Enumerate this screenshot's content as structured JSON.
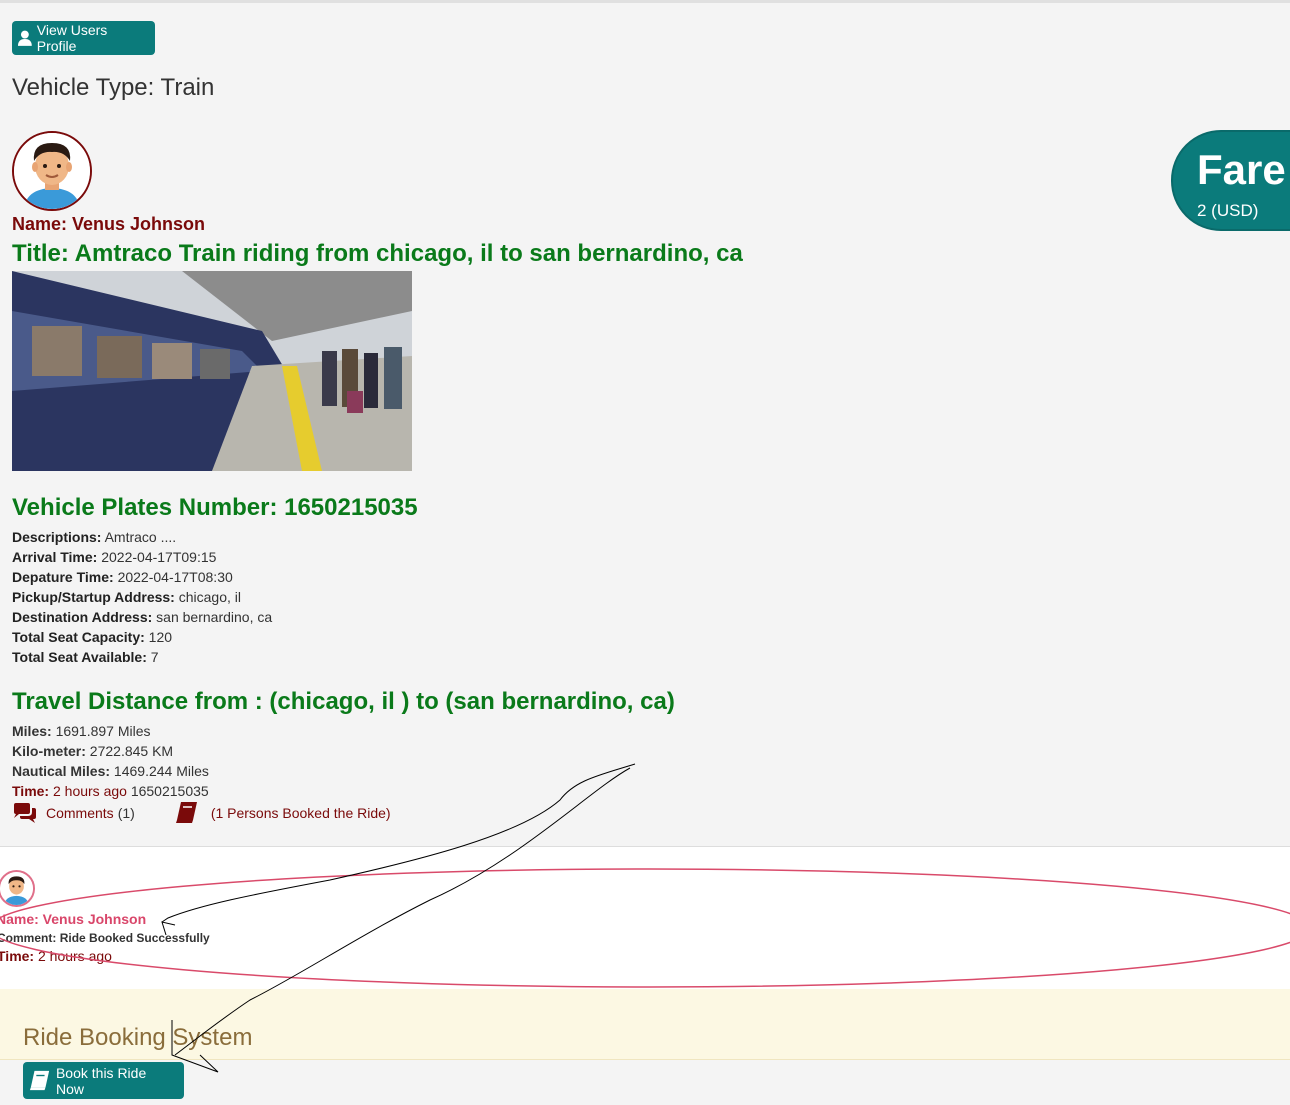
{
  "header": {
    "view_profile_label": "View Users Profile",
    "vehicle_type": "Vehicle Type: Train"
  },
  "ride": {
    "name_label": "Name: Venus Johnson",
    "title": "Title: Amtraco Train riding from chicago, il to san bernardino, ca",
    "plates": "Vehicle Plates Number: 1650215035",
    "details": [
      {
        "label": "Descriptions:",
        "value": "Amtraco ...."
      },
      {
        "label": "Arrival Time:",
        "value": "2022-04-17T09:15"
      },
      {
        "label": "Depature Time:",
        "value": "2022-04-17T08:30"
      },
      {
        "label": "Pickup/Startup Address:",
        "value": "chicago, il"
      },
      {
        "label": "Destination Address:",
        "value": "san bernardino, ca"
      },
      {
        "label": "Total Seat Capacity:",
        "value": "120"
      },
      {
        "label": "Total Seat Available:",
        "value": "7"
      }
    ],
    "distance_heading": "Travel Distance from : (chicago, il ) to (san bernardino, ca)",
    "distance": [
      {
        "label": "Miles:",
        "value": "1691.897 Miles"
      },
      {
        "label": "Kilo-meter:",
        "value": "2722.845 KM"
      },
      {
        "label": "Nautical Miles:",
        "value": "1469.244 Miles"
      }
    ],
    "time_label": "Time:",
    "time_value": "2 hours ago",
    "time_id": "1650215035",
    "comments_link": "Comments",
    "comments_count": "(1)",
    "booked_link": "(1 Persons Booked the Ride)"
  },
  "fare": {
    "label": "Fare",
    "amount": "2 (USD)"
  },
  "comment": {
    "name": "Name: Venus Johnson",
    "comment_label": "Comment:",
    "comment_text": "Ride Booked Successfully",
    "time_label": "Time:",
    "time_value": "2 hours ago"
  },
  "footer": {
    "title": "Ride Booking System",
    "book_button": "Book this Ride Now"
  },
  "colors": {
    "teal": "#0b7b7b",
    "green": "#0a7a1a",
    "maroon": "#7a0a0a",
    "pink": "#d9466a"
  }
}
